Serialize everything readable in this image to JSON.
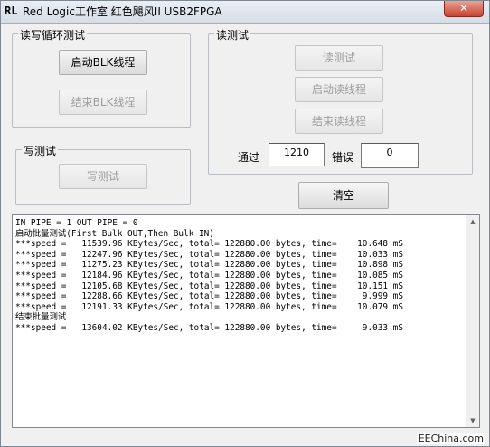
{
  "window": {
    "icon_text": "RL",
    "title": "Red Logic工作室  红色飓风II USB2FPGA",
    "close_glyph": "✕"
  },
  "group_rw": {
    "label": "读写循环测试",
    "start_blk": "启动BLK线程",
    "stop_blk": "结束BLK线程"
  },
  "group_read": {
    "label": "读测试",
    "read_test": "读测试",
    "start_read": "启动读线程",
    "stop_read": "结束读线程",
    "pass_label": "通过",
    "pass_value": "1210",
    "error_label": "错误",
    "error_value": "0"
  },
  "group_write": {
    "label": "写测试",
    "write_test": "写测试"
  },
  "clear_button": "清空",
  "log": {
    "lines": [
      "IN PIPE = 1 OUT PIPE = 0",
      "启动批量测试(First Bulk OUT,Then Bulk IN)",
      "***speed =   11539.96 KBytes/Sec, total= 122880.00 bytes, time=    10.648 mS",
      "***speed =   12247.96 KBytes/Sec, total= 122880.00 bytes, time=    10.033 mS",
      "***speed =   11275.23 KBytes/Sec, total= 122880.00 bytes, time=    10.898 mS",
      "***speed =   12184.96 KBytes/Sec, total= 122880.00 bytes, time=    10.085 mS",
      "***speed =   12105.68 KBytes/Sec, total= 122880.00 bytes, time=    10.151 mS",
      "***speed =   12288.66 KBytes/Sec, total= 122880.00 bytes, time=     9.999 mS",
      "***speed =   12191.33 KBytes/Sec, total= 122880.00 bytes, time=    10.079 mS",
      "结束批量测试",
      "***speed =   13604.02 KBytes/Sec, total= 122880.00 bytes, time=     9.033 mS"
    ]
  },
  "watermark": "EEChina.com"
}
